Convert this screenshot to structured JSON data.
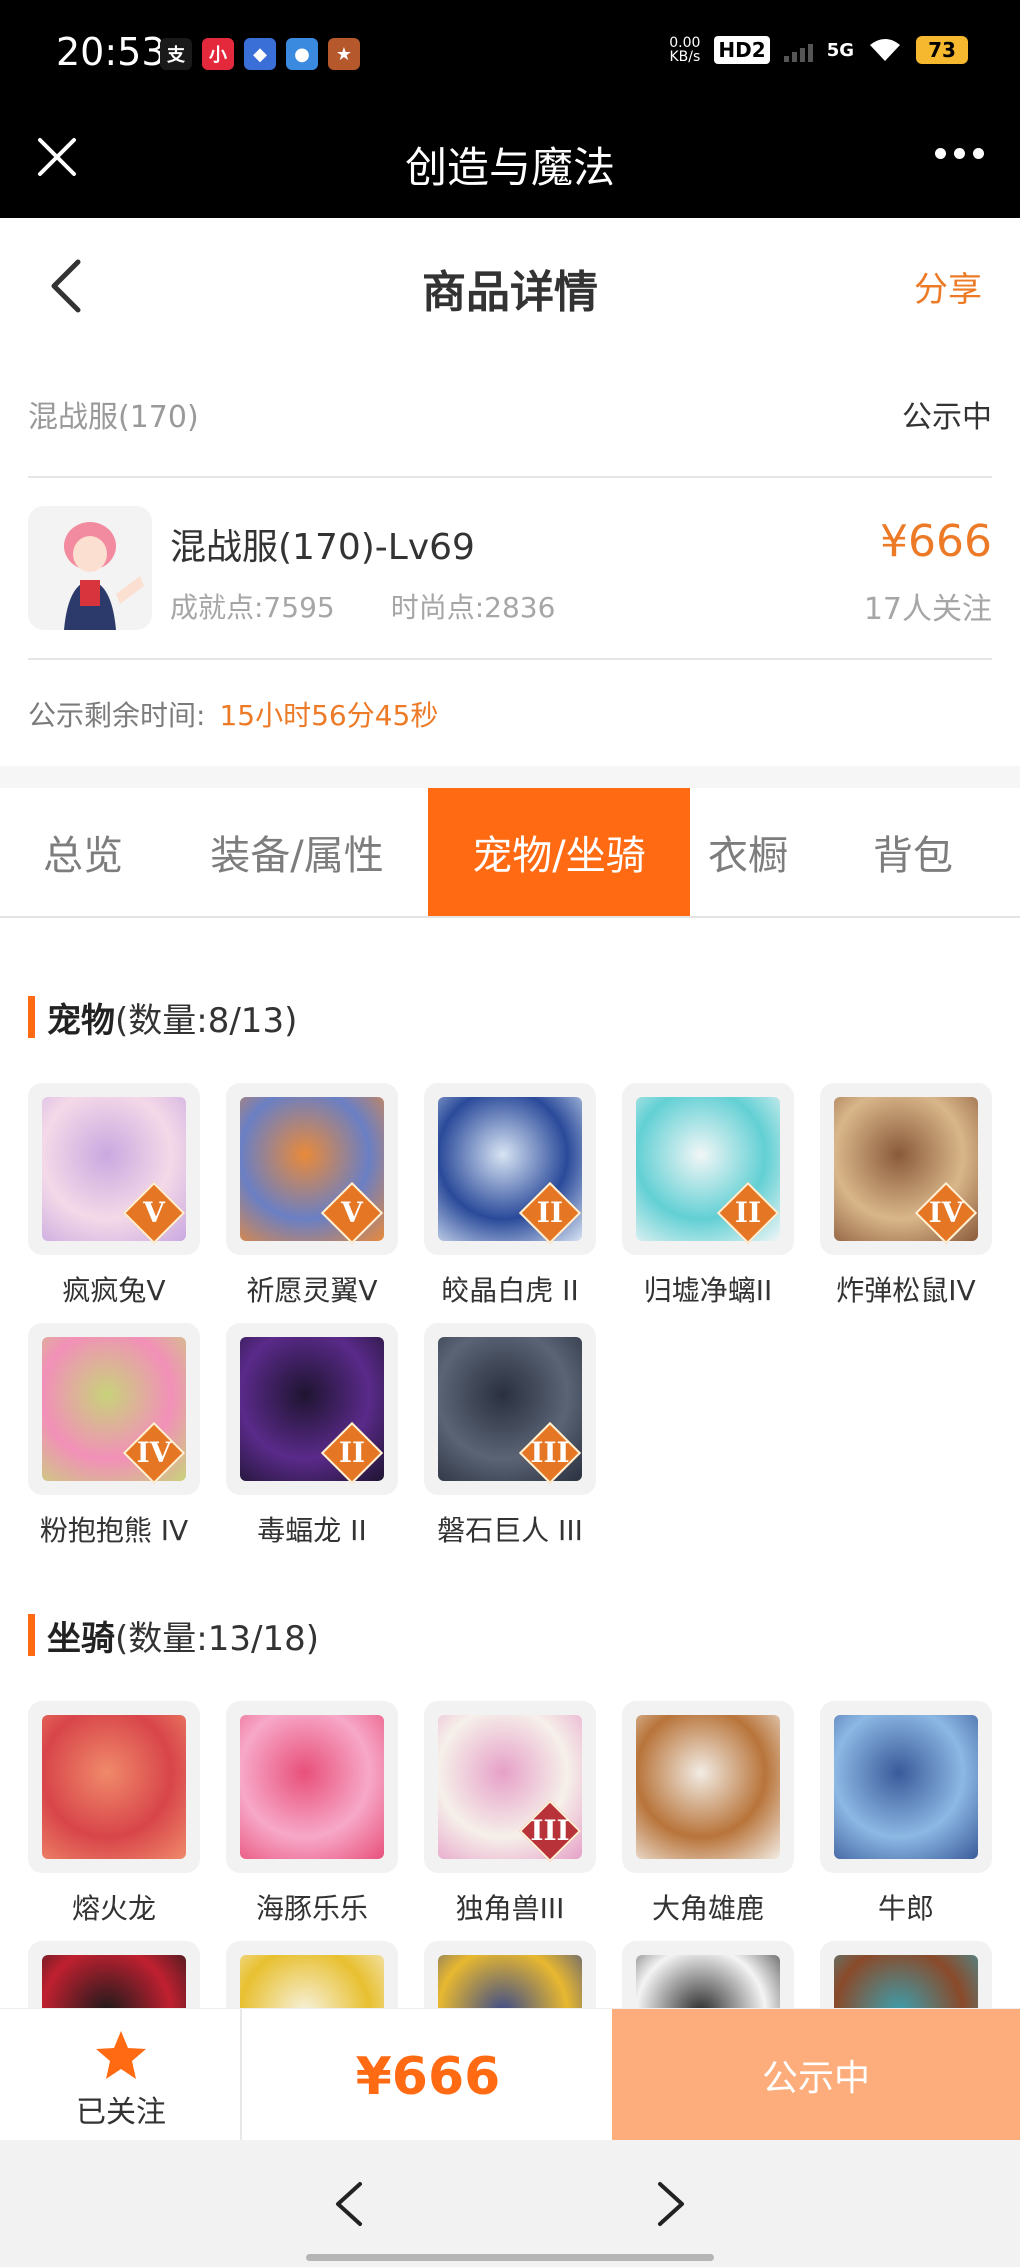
{
  "status_bar": {
    "time": "20:53",
    "apps": [
      {
        "icon": "alipay-icon",
        "glyph": "支",
        "color": "#1a1a1a"
      },
      {
        "icon": "xiaohongshu-icon",
        "glyph": "小",
        "color": "#e4293c"
      },
      {
        "icon": "game-app-icon-1",
        "glyph": "◆",
        "color": "#3b6fd8"
      },
      {
        "icon": "game-app-icon-2",
        "glyph": "●",
        "color": "#3a8be0"
      },
      {
        "icon": "game-app-icon-3",
        "glyph": "★",
        "color": "#b5582c"
      }
    ],
    "net_speed_value": "0.00",
    "net_speed_unit": "KB/s",
    "hd_label": "HD2",
    "network": "5G",
    "battery": "73"
  },
  "title_bar": {
    "title": "创造与魔法"
  },
  "page_header": {
    "title": "商品详情",
    "share_label": "分享"
  },
  "server": {
    "name": "混战服(170)",
    "status": "公示中"
  },
  "product": {
    "name": "混战服(170)-Lv69",
    "achievement": "成就点:7595",
    "fashion": "时尚点:2836",
    "price": "¥666",
    "followers": "17人关注"
  },
  "remaining": {
    "label": "公示剩余时间:",
    "value": "15小时56分45秒"
  },
  "tabs": [
    {
      "label": "总览",
      "active": false
    },
    {
      "label": "装备/属性",
      "active": false
    },
    {
      "label": "宠物/坐骑",
      "active": true
    },
    {
      "label": "衣橱",
      "active": false
    },
    {
      "label": "背包",
      "active": false
    }
  ],
  "pets": {
    "title": "宠物",
    "count": "(数量:8/13)",
    "items": [
      {
        "label": "疯疯兔V",
        "icon": "crazy-rabbit-pet-icon",
        "badge": "V",
        "color1": "#f4d9e8",
        "color2": "#c9a8e0"
      },
      {
        "label": "祈愿灵翼V",
        "icon": "wish-wing-pet-icon",
        "badge": "V",
        "color1": "#6a7fc4",
        "color2": "#e98a3a"
      },
      {
        "label": "皎晶白虎 II",
        "icon": "crystal-white-tiger-pet-icon",
        "badge": "II",
        "color1": "#2a4a9a",
        "color2": "#d8e4f4"
      },
      {
        "label": "归墟净螭II",
        "icon": "guixu-dragon-pet-icon",
        "badge": "II",
        "color1": "#62d0d4",
        "color2": "#f2f6f7"
      },
      {
        "label": "炸弹松鼠IV",
        "icon": "bomb-squirrel-pet-icon",
        "badge": "IV",
        "color1": "#d9b68a",
        "color2": "#8a5a3a"
      },
      {
        "label": "粉抱抱熊 IV",
        "icon": "pink-hug-bear-pet-icon",
        "badge": "IV",
        "color1": "#f290b8",
        "color2": "#c8d27a"
      },
      {
        "label": "毒蝠龙 II",
        "icon": "poison-bat-dragon-pet-icon",
        "badge": "II",
        "color1": "#5a2a8a",
        "color2": "#1e1430"
      },
      {
        "label": "磐石巨人 III",
        "icon": "rock-giant-pet-icon",
        "badge": "III",
        "color1": "#5a6474",
        "color2": "#2a3040"
      }
    ]
  },
  "mounts": {
    "title": "坐骑",
    "count": "(数量:13/18)",
    "items": [
      {
        "label": "熔火龙",
        "icon": "lava-dragon-mount-icon",
        "badge": "",
        "color1": "#d8454a",
        "color2": "#f08a6a"
      },
      {
        "label": "海豚乐乐",
        "icon": "dolphin-lele-mount-icon",
        "badge": "",
        "color1": "#f7a8c8",
        "color2": "#e8507a"
      },
      {
        "label": "独角兽III",
        "icon": "unicorn-mount-icon",
        "badge": "III",
        "color1": "#f6f0ea",
        "color2": "#e6a0c8"
      },
      {
        "label": "大角雄鹿",
        "icon": "great-antler-deer-mount-icon",
        "badge": "",
        "color1": "#b8743a",
        "color2": "#f2ece4"
      },
      {
        "label": "牛郎",
        "icon": "cowherd-mount-icon",
        "badge": "",
        "color1": "#8cb8e4",
        "color2": "#3a5a9a"
      },
      {
        "label": "",
        "icon": "mount-6-icon",
        "badge": "",
        "color1": "#c02030",
        "color2": "#1a1a1a"
      },
      {
        "label": "",
        "icon": "mount-7-icon",
        "badge": "",
        "color1": "#e8c030",
        "color2": "#f7f2de"
      },
      {
        "label": "",
        "icon": "mount-8-icon",
        "badge": "",
        "color1": "#e8b830",
        "color2": "#3a4a8a"
      },
      {
        "label": "",
        "icon": "mount-9-icon",
        "badge": "",
        "color1": "#f4f4f4",
        "color2": "#2a2a2a"
      },
      {
        "label": "",
        "icon": "mount-10-icon",
        "badge": "",
        "color1": "#8a4a2a",
        "color2": "#3aa0b0"
      }
    ]
  },
  "bottom_bar": {
    "follow_label": "已关注",
    "price": "¥666",
    "action_label": "公示中"
  },
  "colors": {
    "accent": "#ff6a13",
    "price": "#ec7a26",
    "action_disabled": "#fcad7b"
  }
}
